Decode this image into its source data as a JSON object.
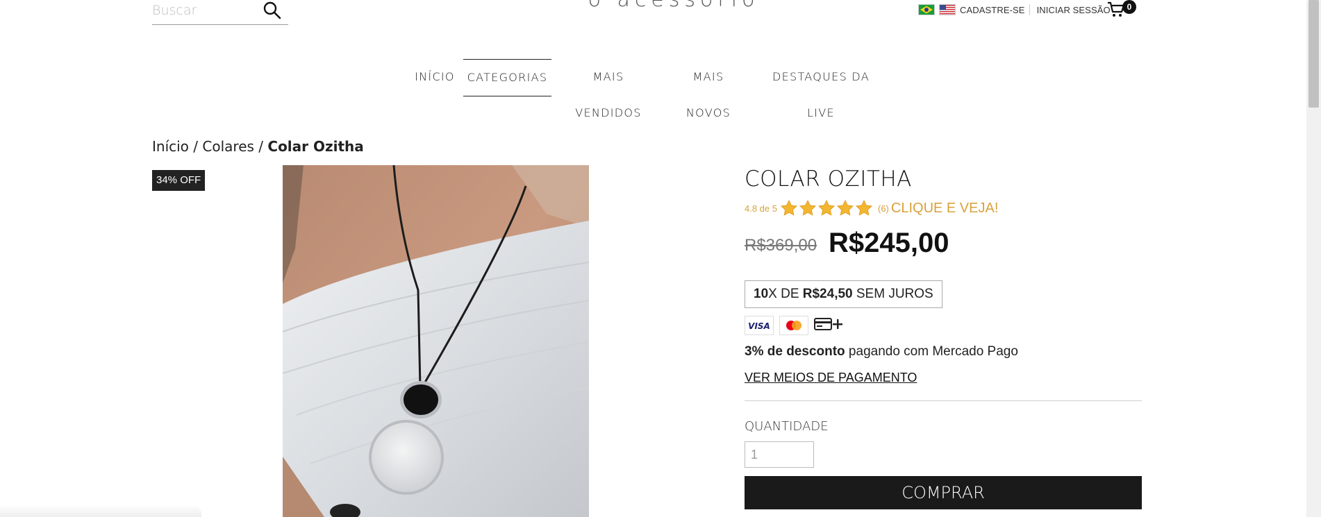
{
  "header": {
    "search": {
      "placeholder": "Buscar",
      "value": ""
    },
    "logo_text": "o acessorio",
    "languages": [
      {
        "icon": "brazil-flag-icon"
      },
      {
        "icon": "usa-flag-icon"
      }
    ],
    "register_label": "CADASTRE-SE",
    "login_label": "INICIAR SESSÃO",
    "cart_count": "0"
  },
  "nav": {
    "items": [
      {
        "label": "INÍCIO"
      },
      {
        "label": "CATEGORIAS"
      },
      {
        "label": "MAIS VENDIDOS"
      },
      {
        "label": "MAIS NOVOS"
      },
      {
        "label": "DESTAQUES DA LIVE"
      }
    ],
    "active_index": 1
  },
  "breadcrumb": {
    "home": "Início",
    "sep": "/",
    "category": "Colares",
    "current": "Colar Ozitha"
  },
  "product": {
    "badge": "34% OFF",
    "title": "COLAR OZITHA",
    "rating": {
      "text": "4.8 de 5",
      "stars": 5,
      "count": "(6)",
      "link_label": "CLIQUE E VEJA!"
    },
    "price_old": "R$369,00",
    "price_new": "R$245,00",
    "installments": {
      "count": "10",
      "prefix": "X DE ",
      "value": "R$24,50",
      "suffix": " SEM JUROS"
    },
    "payment_icons": [
      "visa-icon",
      "mastercard-icon",
      "credit-card-icon",
      "plus-icon"
    ],
    "discount_bold": "3% de desconto",
    "discount_text": " pagando com Mercado Pago",
    "payment_link": "VER MEIOS DE PAGAMENTO",
    "quantity_label": "QUANTIDADE",
    "quantity_value": "1",
    "buy_label": "COMPRAR"
  },
  "colors": {
    "accent": "#d8a13a",
    "button": "#1a1a1a",
    "badge": "#222222"
  }
}
